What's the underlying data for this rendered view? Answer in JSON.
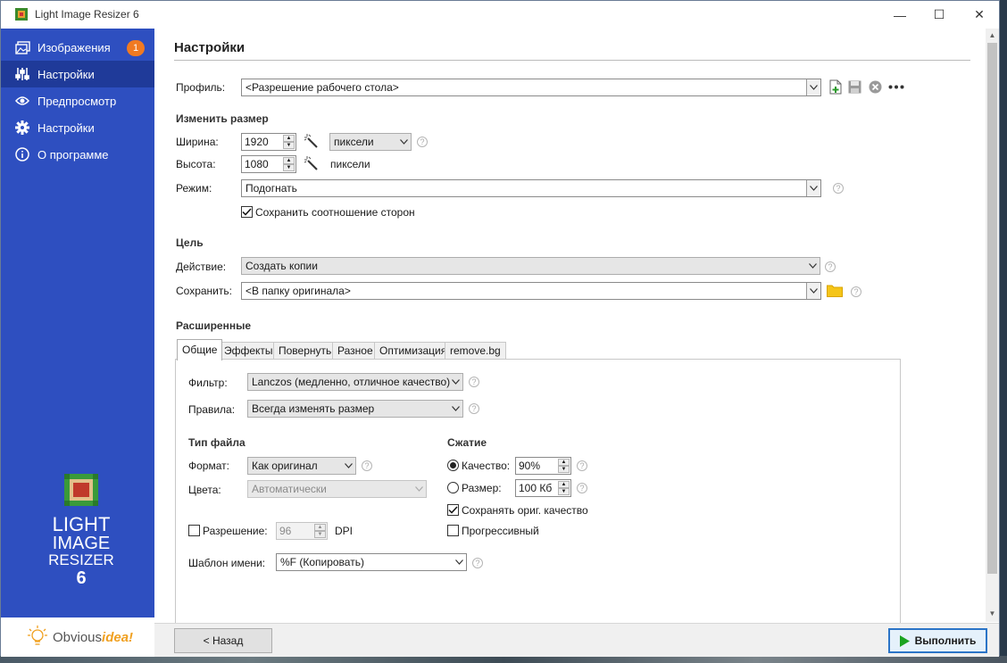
{
  "window": {
    "title": "Light Image Resizer 6",
    "minimize": "—",
    "maximize": "☐",
    "close": "✕"
  },
  "sidebar": {
    "items": [
      {
        "label": "Изображения",
        "icon": "images-icon",
        "badge": "1"
      },
      {
        "label": "Настройки",
        "icon": "sliders-icon",
        "active": true
      },
      {
        "label": "Предпросмотр",
        "icon": "eye-icon"
      },
      {
        "label": "Настройки",
        "icon": "gear-icon"
      },
      {
        "label": "О программе",
        "icon": "info-icon"
      }
    ],
    "logo": {
      "line1": "LIGHT",
      "line2": "IMAGE",
      "line3": "RESIZER",
      "line4": "6"
    },
    "vendor": {
      "prefix": "Obvious",
      "suffix": "idea!"
    }
  },
  "main": {
    "title": "Настройки",
    "profile": {
      "label": "Профиль:",
      "value": "<Разрешение рабочего стола>"
    },
    "resize": {
      "heading": "Изменить размер",
      "width_label": "Ширина:",
      "width_value": "1920",
      "width_unit": "пиксели",
      "height_label": "Высота:",
      "height_value": "1080",
      "height_unit": "пиксели",
      "mode_label": "Режим:",
      "mode_value": "Подогнать",
      "keep_ratio_label": "Сохранить соотношение сторон",
      "keep_ratio_checked": true
    },
    "target": {
      "heading": "Цель",
      "action_label": "Действие:",
      "action_value": "Создать копии",
      "save_label": "Сохранить:",
      "save_value": "<В папку оригинала>"
    },
    "advanced": {
      "heading": "Расширенные",
      "tabs": [
        "Общие",
        "Эффекты",
        "Повернуть",
        "Разное",
        "Оптимизация",
        "remove.bg"
      ],
      "active_tab": "Общие",
      "filter_label": "Фильтр:",
      "filter_value": "Lanczos  (медленно, отличное качество)",
      "rules_label": "Правила:",
      "rules_value": "Всегда изменять размер",
      "filetype_heading": "Тип файла",
      "format_label": "Формат:",
      "format_value": "Как оригинал",
      "colors_label": "Цвета:",
      "colors_value": "Автоматически",
      "resolution_label": "Разрешение:",
      "resolution_value": "96",
      "resolution_unit": "DPI",
      "resolution_checked": false,
      "name_template_label": "Шаблон имени:",
      "name_template_value": "%F (Копировать)",
      "compression_heading": "Сжатие",
      "quality_label": "Качество:",
      "quality_value": "90%",
      "quality_selected": true,
      "size_label": "Размер:",
      "size_value": "100 Кб",
      "size_selected": false,
      "keep_quality_label": "Сохранять ориг. качество",
      "keep_quality_checked": true,
      "progressive_label": "Прогрессивный",
      "progressive_checked": false
    }
  },
  "footer": {
    "back_label": "< Назад",
    "run_label": "Выполнить"
  },
  "colors": {
    "sidebar": "#2e4fc0",
    "sidebar_active": "#1f3a99",
    "badge": "#f07a22",
    "run_arrow": "#1aa321",
    "folder": "#f5c518"
  }
}
